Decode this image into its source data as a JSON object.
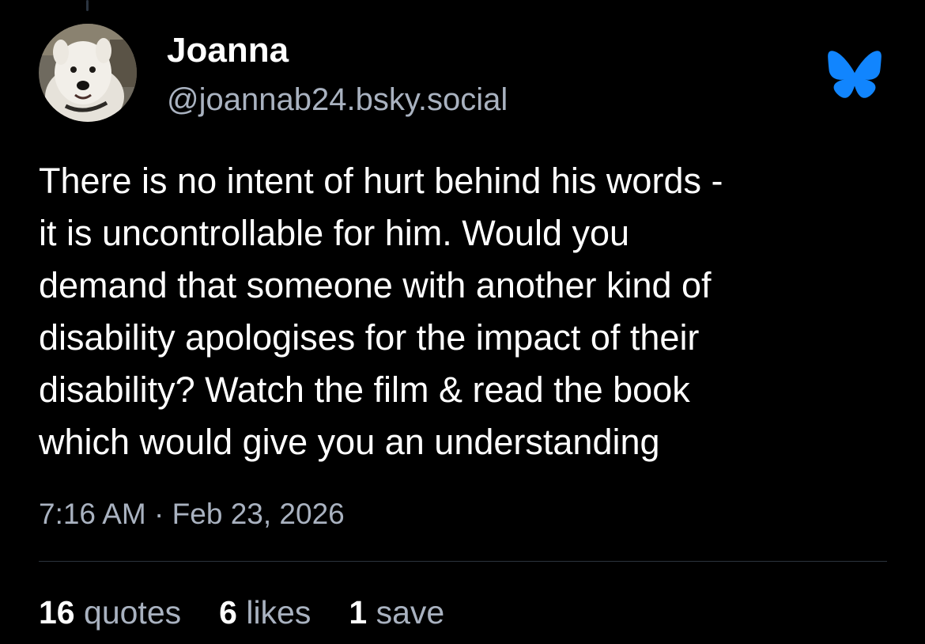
{
  "post": {
    "author": {
      "name": "Joanna",
      "handle": "@joannab24.bsky.social"
    },
    "text": "There is no intent of hurt behind his words -\nit is uncontrollable for him. Would you\ndemand that someone with another kind of\ndisability apologises for the impact of their\ndisability? Watch the film & read the book\nwhich would give you an understanding",
    "time": "7:16 AM",
    "date": "Feb 23, 2026",
    "separator": "·"
  },
  "stats": {
    "quotes": {
      "count": "16",
      "label": "quotes"
    },
    "likes": {
      "count": "6",
      "label": "likes"
    },
    "saves": {
      "count": "1",
      "label": "save"
    }
  },
  "icons": {
    "bluesky": "bluesky-butterfly-icon",
    "avatar": "dog-avatar"
  },
  "colors": {
    "background": "#000000",
    "text": "#ffffff",
    "secondary_text": "#a9b2c0",
    "brand": "#1185fe",
    "divider": "#2b333d"
  }
}
